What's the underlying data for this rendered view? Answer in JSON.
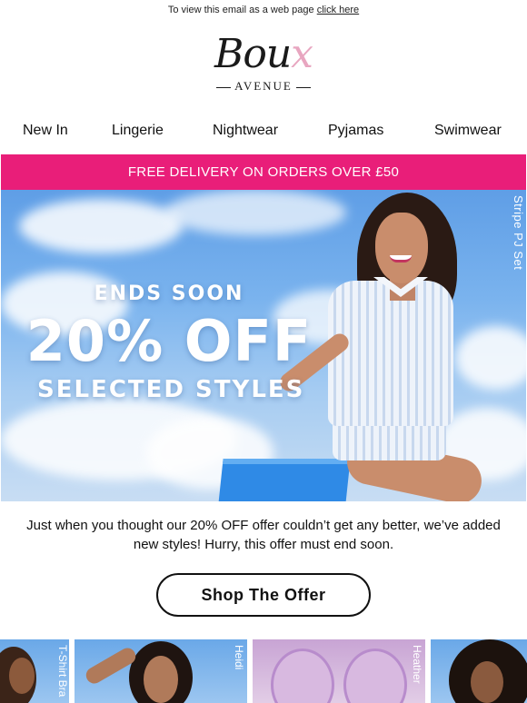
{
  "header": {
    "webview_text": "To view this email as a web page",
    "webview_link": "click here"
  },
  "logo": {
    "word_main": "Bou",
    "word_x": "x",
    "subtitle": "AVENUE"
  },
  "nav": {
    "items": [
      {
        "label": "New In"
      },
      {
        "label": "Lingerie"
      },
      {
        "label": "Nightwear"
      },
      {
        "label": "Pyjamas"
      },
      {
        "label": "Swimwear"
      }
    ]
  },
  "promo_bar": {
    "text": "FREE DELIVERY ON ORDERS OVER £50",
    "color": "#e91e79"
  },
  "hero": {
    "line1": "ENDS SOON",
    "line2": "20% OFF",
    "line3": "SELECTED STYLES",
    "side_tag": "Stripe PJ Set"
  },
  "body": {
    "copy": "Just when you thought our 20% OFF offer couldn’t get any better, we’ve added new styles! Hurry, this offer must end soon."
  },
  "cta": {
    "label": "Shop The Offer"
  },
  "thumbnails": [
    {
      "label": "T-Shirt Bra"
    },
    {
      "label": "Heidi"
    },
    {
      "label": "Heather"
    },
    {
      "label": ""
    }
  ]
}
